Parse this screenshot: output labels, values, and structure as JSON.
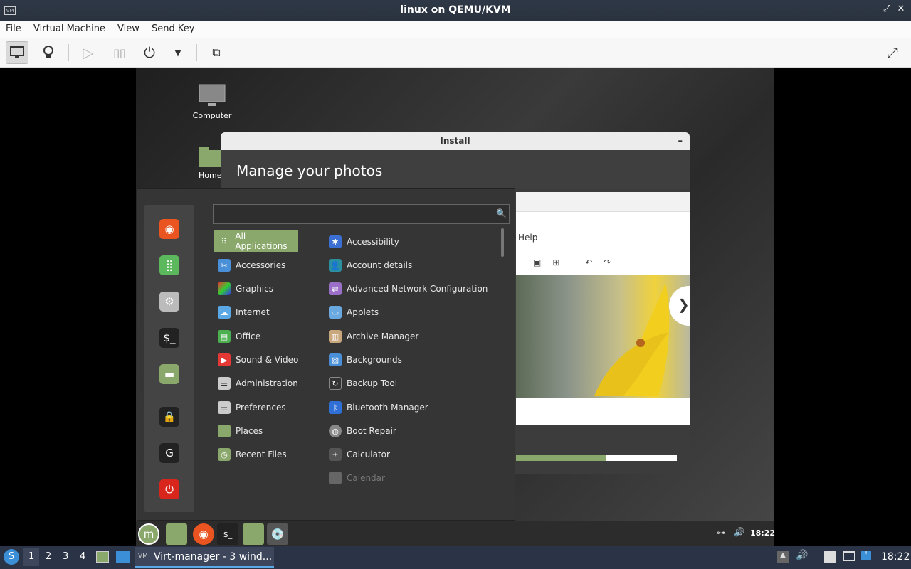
{
  "window": {
    "title": "linux on QEMU/KVM",
    "app_icon_text": "VM"
  },
  "menubar": [
    "File",
    "Virtual Machine",
    "View",
    "Send Key"
  ],
  "toolbar": {
    "icons": [
      "monitor-icon",
      "lightbulb-icon",
      "play-icon",
      "pause-icon",
      "power-icon",
      "dropdown-icon",
      "screenshot-icon",
      "fullscreen-icon"
    ]
  },
  "desktop": {
    "icons": [
      {
        "label": "Computer"
      },
      {
        "label": "Home"
      }
    ]
  },
  "install": {
    "title": "Install",
    "heading": "Manage your photos",
    "viewer_menu_help": "Help",
    "progress": 0.56
  },
  "menu": {
    "search_value": "",
    "categories": [
      "All Applications",
      "Accessories",
      "Graphics",
      "Internet",
      "Office",
      "Sound & Video",
      "Administration",
      "Preferences",
      "Places",
      "Recent Files"
    ],
    "apps": [
      "Accessibility",
      "Account details",
      "Advanced Network Configuration",
      "Applets",
      "Archive Manager",
      "Backgrounds",
      "Backup Tool",
      "Bluetooth Manager",
      "Boot Repair",
      "Calculator",
      "Calendar"
    ],
    "selected_category": "All Applications"
  },
  "vm_panel": {
    "clock": "18:22"
  },
  "taskbar": {
    "workspaces": [
      "1",
      "2",
      "3",
      "4"
    ],
    "active_window": "Virt-manager - 3 wind...",
    "clock": "18:22"
  },
  "colors": {
    "accent": "#8aa86b",
    "titlebar": "#2a323f",
    "taskbar": "#2b3346"
  }
}
